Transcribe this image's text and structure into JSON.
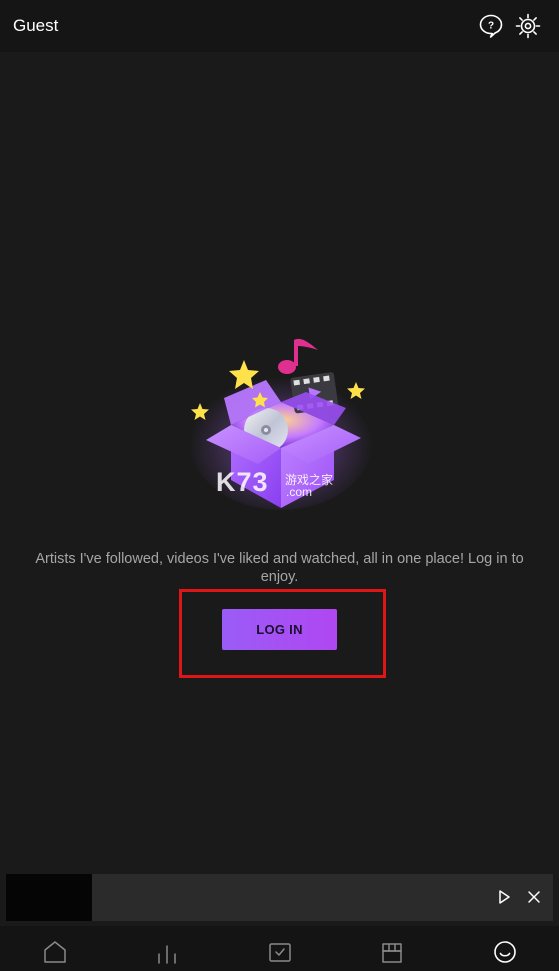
{
  "header": {
    "title": "Guest",
    "help_icon": "help-question-icon",
    "settings_icon": "gear-icon"
  },
  "illustration": {
    "icon": "gift-box-music-illustration",
    "watermark": {
      "main": "K73",
      "cn": "游戏之家",
      "domain": ".com"
    }
  },
  "main": {
    "message": "Artists I've followed, videos I've liked and watched, all in one place! Log in to enjoy.",
    "login_label": "LOG IN",
    "accent": "#a653f4",
    "highlight_color": "#e01515"
  },
  "mini_player": {
    "play_icon": "play-icon",
    "close_icon": "close-icon"
  },
  "bottom_nav": {
    "items": [
      {
        "icon": "home-icon"
      },
      {
        "icon": "charts-icon"
      },
      {
        "icon": "library-icon"
      },
      {
        "icon": "store-icon"
      },
      {
        "icon": "smiley-profile-icon",
        "active": true
      }
    ]
  }
}
